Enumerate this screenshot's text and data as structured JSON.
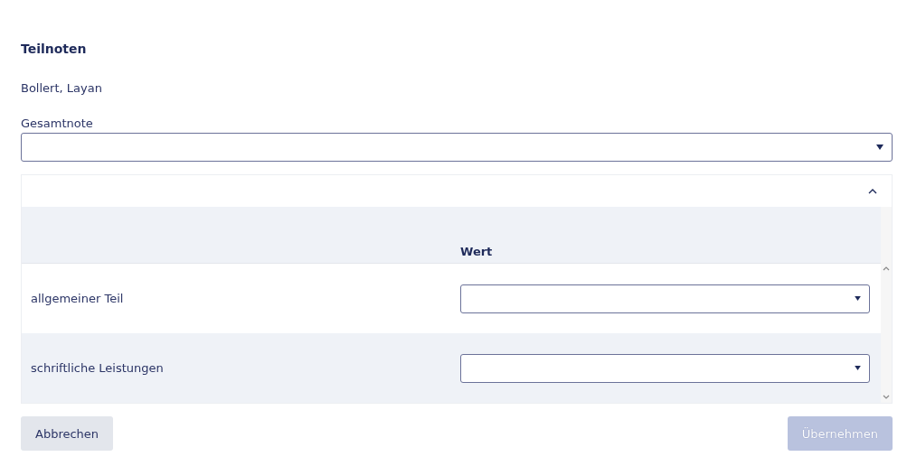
{
  "title": "Teilnoten",
  "student": "Bollert, Layan",
  "overall_grade": {
    "label": "Gesamtnote"
  },
  "panel": {
    "expanded": true,
    "columns": [
      {
        "label": "Wert"
      }
    ],
    "rows": [
      {
        "label": "allgemeiner Teil"
      },
      {
        "label": "schriftliche Leistungen"
      }
    ]
  },
  "buttons": [
    {
      "label": "Abbrechen",
      "kind": "secondary",
      "disabled": false
    },
    {
      "label": "Übernehmen",
      "kind": "primary",
      "disabled": true
    }
  ]
}
